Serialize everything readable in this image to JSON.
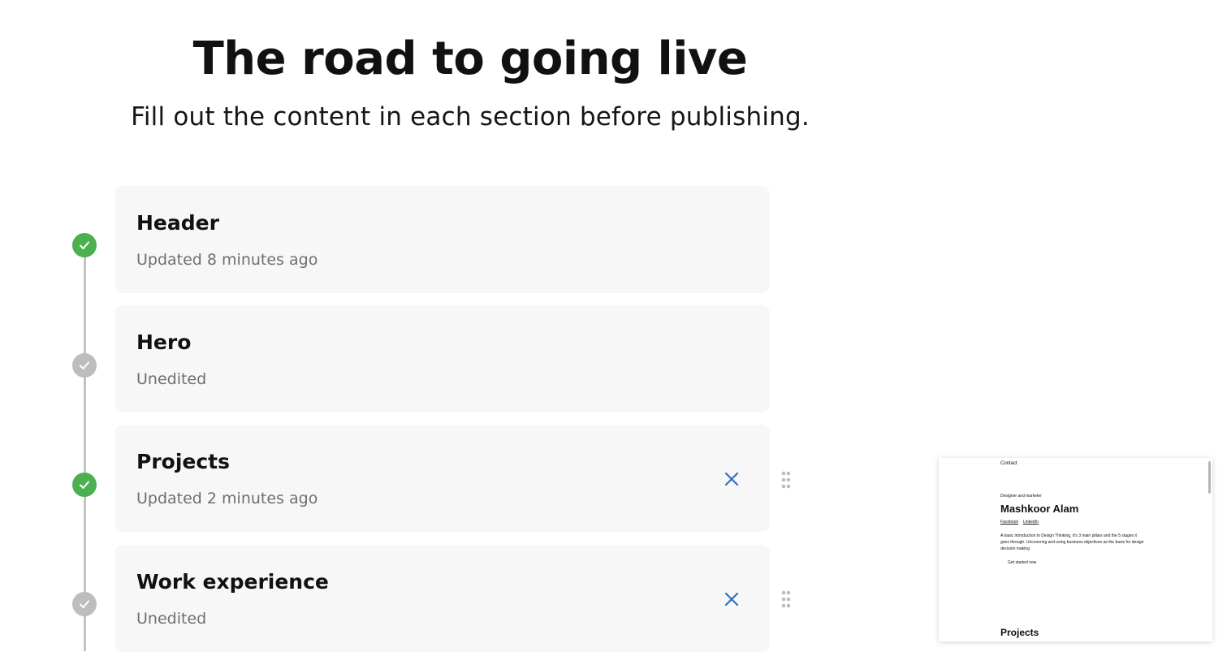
{
  "page": {
    "title": "The road to going live",
    "subtitle": "Fill out the content in each section before publishing."
  },
  "sections": [
    {
      "title": "Header",
      "status": "Updated 8 minutes ago",
      "state": "done"
    },
    {
      "title": "Hero",
      "status": "Unedited",
      "state": "pending"
    },
    {
      "title": "Projects",
      "status": "Updated 2 minutes ago",
      "state": "done"
    },
    {
      "title": "Work experience",
      "status": "Unedited",
      "state": "pending"
    }
  ],
  "colors": {
    "done": "#4caf50",
    "pending": "#bdbdbd",
    "accent": "#2f6fc0",
    "card_bg": "#f7f7f7"
  },
  "icons": {
    "check": "check-icon",
    "remove": "close-icon",
    "drag": "drag-handle-icon"
  },
  "preview": {
    "nav_contact": "Contact",
    "role": "Designer and marketer",
    "name": "Mashkoor Alam",
    "links": [
      "Facebook",
      "LinkedIn"
    ],
    "description": "A basic introduction to Design Thinking, it's 3 main pillars and the 5 stages it goes through. Uncovering and using business objectives as the basis for design decision making",
    "cta": "Get started now",
    "next_section": "Projects"
  }
}
